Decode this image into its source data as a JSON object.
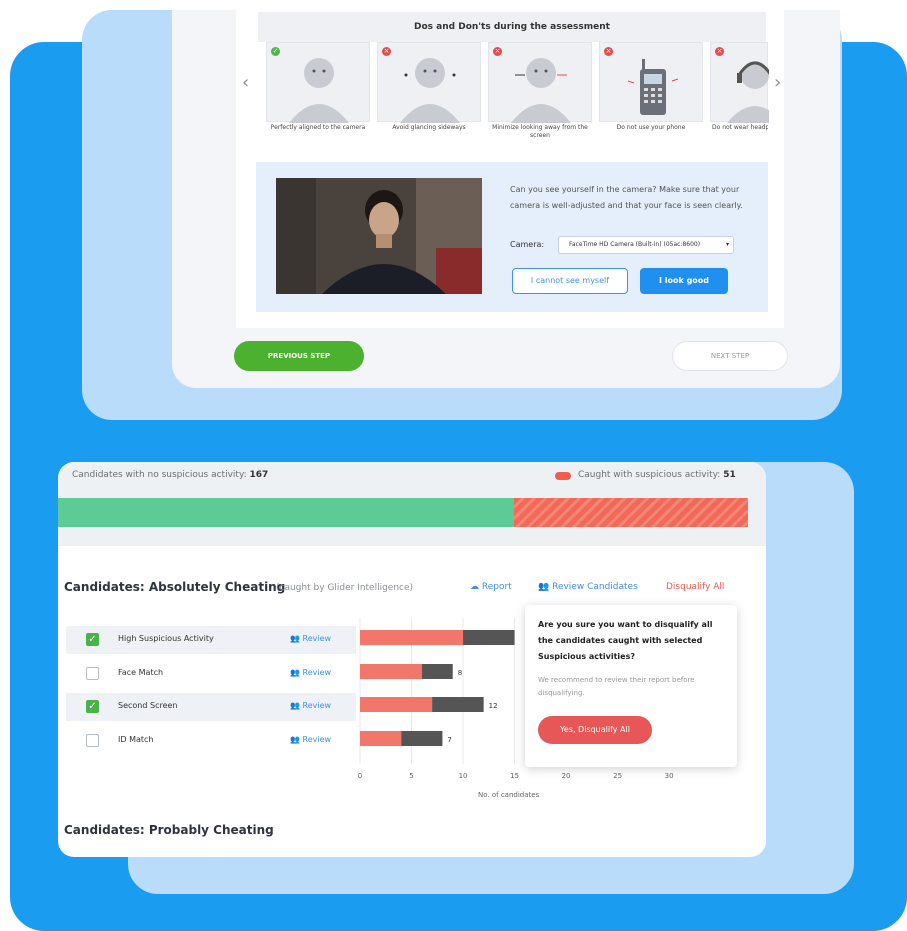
{
  "assessment": {
    "header": "Dos and Don'ts during the assessment",
    "tiles": [
      {
        "caption": "Perfectly aligned to the camera",
        "status": "ok"
      },
      {
        "caption": "Avoid glancing sideways",
        "status": "no"
      },
      {
        "caption": "Minimize looking away from the screen",
        "status": "no"
      },
      {
        "caption": "Do not use your phone",
        "status": "no"
      },
      {
        "caption": "Do not wear headphones",
        "status": "no"
      }
    ],
    "camera_prompt": "Can you see yourself in the camera? Make sure that your camera is well-adjusted and that your face is seen clearly.",
    "camera_label": "Camera:",
    "camera_value": "FaceTime HD Camera (Built-in) (05ac:8600)",
    "cant_see_label": "I cannot see myself",
    "look_good_label": "I look good",
    "prev_label": "PREVIOUS STEP",
    "next_label": "NEXT STEP"
  },
  "summary": {
    "no_suspicious_label": "Candidates with no suspicious activity:",
    "no_suspicious_count": "167",
    "caught_label": "Caught with suspicious activity:",
    "caught_count": "51"
  },
  "cheating": {
    "title": "Candidates: Absolutely Cheating",
    "subtitle": "(caught by Glider Intelligence)",
    "report_label": "Report",
    "review_candidates_label": "Review Candidates",
    "disqualify_all_label": "Disqualify All",
    "review_label": "Review",
    "rows": [
      {
        "label": "High Suspicious Activity",
        "checked": true
      },
      {
        "label": "Face Match",
        "checked": false
      },
      {
        "label": "Second Screen",
        "checked": true
      },
      {
        "label": "ID Match",
        "checked": false
      }
    ],
    "probably_title": "Candidates: Probably Cheating"
  },
  "popover": {
    "question": "Are you sure you want to disqualify all the candidates caught with selected Suspicious activities?",
    "note": "We recommend to review their report before disqualifying.",
    "confirm_label": "Yes, Disqualify All"
  },
  "chart_data": {
    "type": "bar",
    "orientation": "horizontal",
    "stacked": true,
    "categories": [
      "High Suspicious Activity",
      "Face Match",
      "Second Screen",
      "ID Match"
    ],
    "series": [
      {
        "values": [
          10,
          6,
          7,
          4
        ],
        "color": "#f2776b"
      },
      {
        "values": [
          5,
          3,
          5,
          4
        ],
        "color": "#555555"
      }
    ],
    "totals": [
      "",
      "8",
      "12",
      "7"
    ],
    "xticks": [
      0,
      5,
      10,
      15,
      20,
      25,
      30
    ],
    "xlim": [
      0,
      33
    ],
    "xlabel": "No. of candidates"
  },
  "colors": {
    "blue": "#1a9df0",
    "green": "#5ccb95",
    "red": "#f26a57",
    "primary": "#1f8ff0"
  }
}
